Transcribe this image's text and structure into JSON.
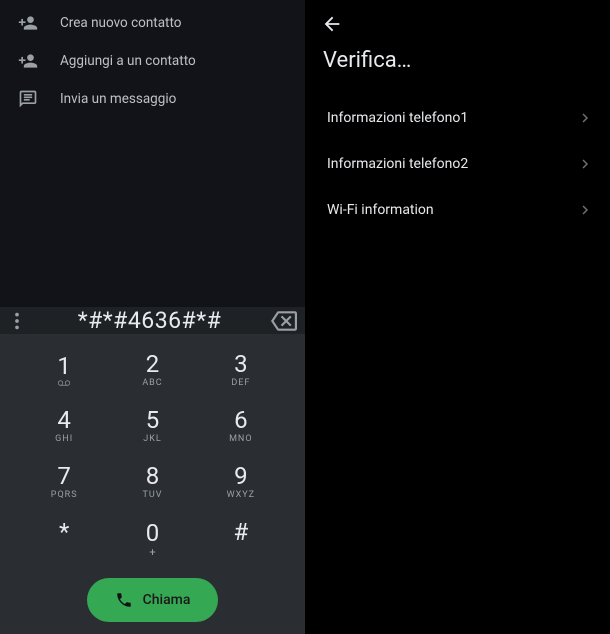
{
  "left": {
    "actions": [
      {
        "label": "Crea nuovo contatto",
        "icon": "person-add"
      },
      {
        "label": "Aggiungi a un contatto",
        "icon": "person-add"
      },
      {
        "label": "Invia un messaggio",
        "icon": "message"
      }
    ],
    "dialed": "*#*#4636#*#",
    "keypad": [
      {
        "d": "1",
        "s": "vm"
      },
      {
        "d": "2",
        "s": "ABC"
      },
      {
        "d": "3",
        "s": "DEF"
      },
      {
        "d": "4",
        "s": "GHI"
      },
      {
        "d": "5",
        "s": "JKL"
      },
      {
        "d": "6",
        "s": "MNO"
      },
      {
        "d": "7",
        "s": "PQRS"
      },
      {
        "d": "8",
        "s": "TUV"
      },
      {
        "d": "9",
        "s": "WXYZ"
      },
      {
        "d": "*",
        "s": ""
      },
      {
        "d": "0",
        "s": "+"
      },
      {
        "d": "#",
        "s": ""
      }
    ],
    "call_label": "Chiama"
  },
  "right": {
    "title": "Verifica…",
    "items": [
      {
        "label": "Informazioni telefono1"
      },
      {
        "label": "Informazioni telefono2"
      },
      {
        "label": "Wi-Fi information"
      }
    ]
  }
}
